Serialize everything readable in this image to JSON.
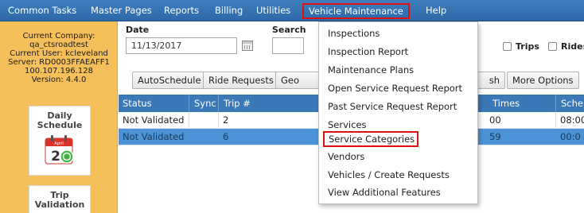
{
  "nav": {
    "items": [
      "Common Tasks",
      "Master Pages",
      "Reports",
      "Billing",
      "Utilities",
      "Vehicle Maintenance",
      "Help"
    ]
  },
  "sidebar": {
    "company_lines": [
      "Current Company:",
      "qa_ctsroadtest",
      "Current User: kcleveland",
      "Server: RD0003FFAEAFF1",
      "100.107.196.128",
      "Version: 4.4.0"
    ],
    "cards": [
      {
        "title_line1": "Daily",
        "title_line2": "Schedule",
        "icon": "calendar-icon",
        "calendar_month": "April",
        "calendar_digit": "2"
      },
      {
        "title_line1": "Trip",
        "title_line2": "Validation",
        "icon": "check-icon"
      }
    ]
  },
  "filters": {
    "date_label": "Date",
    "date_value": "11/13/2017",
    "search_label": "Search",
    "trips_label": "Trips",
    "rides_label": "Rides"
  },
  "buttons": {
    "autoschedule": "AutoSchedule",
    "ride_requests": "Ride Requests",
    "geo": "Geo",
    "refresh_partial": "sh",
    "more_options": "More Options"
  },
  "grid": {
    "headers": {
      "status": "Status",
      "sync": "Sync",
      "trip": "Trip #",
      "times": "Times",
      "sched": "Sche"
    },
    "rows": [
      {
        "status": "Not Validated",
        "trip": "2",
        "times": "00",
        "sched": "08:00"
      },
      {
        "status": "Not Validated",
        "trip": "6",
        "times": "59",
        "sched": "00:0"
      }
    ]
  },
  "dropdown": {
    "items": [
      "Inspections",
      "Inspection Report",
      "Maintenance Plans",
      "Open Service Request Report",
      "Past Service Request Report",
      "Services",
      "Service Categories",
      "Vendors",
      "Vehicles / Create Requests",
      "View Additional Features"
    ]
  },
  "colors": {
    "nav_bg": "#2e68a8",
    "sidebar_bg": "#f5c05a",
    "grid_header": "#3a78b7",
    "selected_row": "#4b93d6",
    "highlight_border": "#e01010"
  }
}
